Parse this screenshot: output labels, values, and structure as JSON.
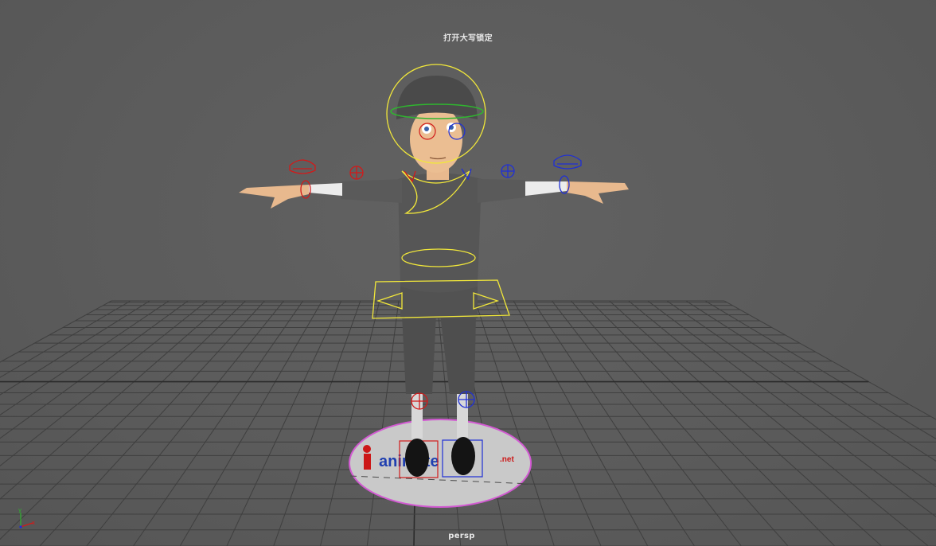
{
  "viewport": {
    "caps_lock_message": "打开大写锁定",
    "camera_name": "persp"
  },
  "axis_indicator": {
    "y_label": "y",
    "x_label": "x"
  },
  "logo": {
    "prefix": "i",
    "text": "animate",
    "suffix": ".net"
  },
  "colors": {
    "viewport_bg": "#5d5d5d",
    "grid": "#3f3f3f",
    "grid_axis": "#2b2b2b",
    "control_yellow": "#f2e83a",
    "control_red": "#d21a1a",
    "control_blue": "#1f2fd6",
    "control_green": "#2fb52f",
    "base_disc": "#c8c8c8",
    "base_outline": "#d25ad2"
  }
}
